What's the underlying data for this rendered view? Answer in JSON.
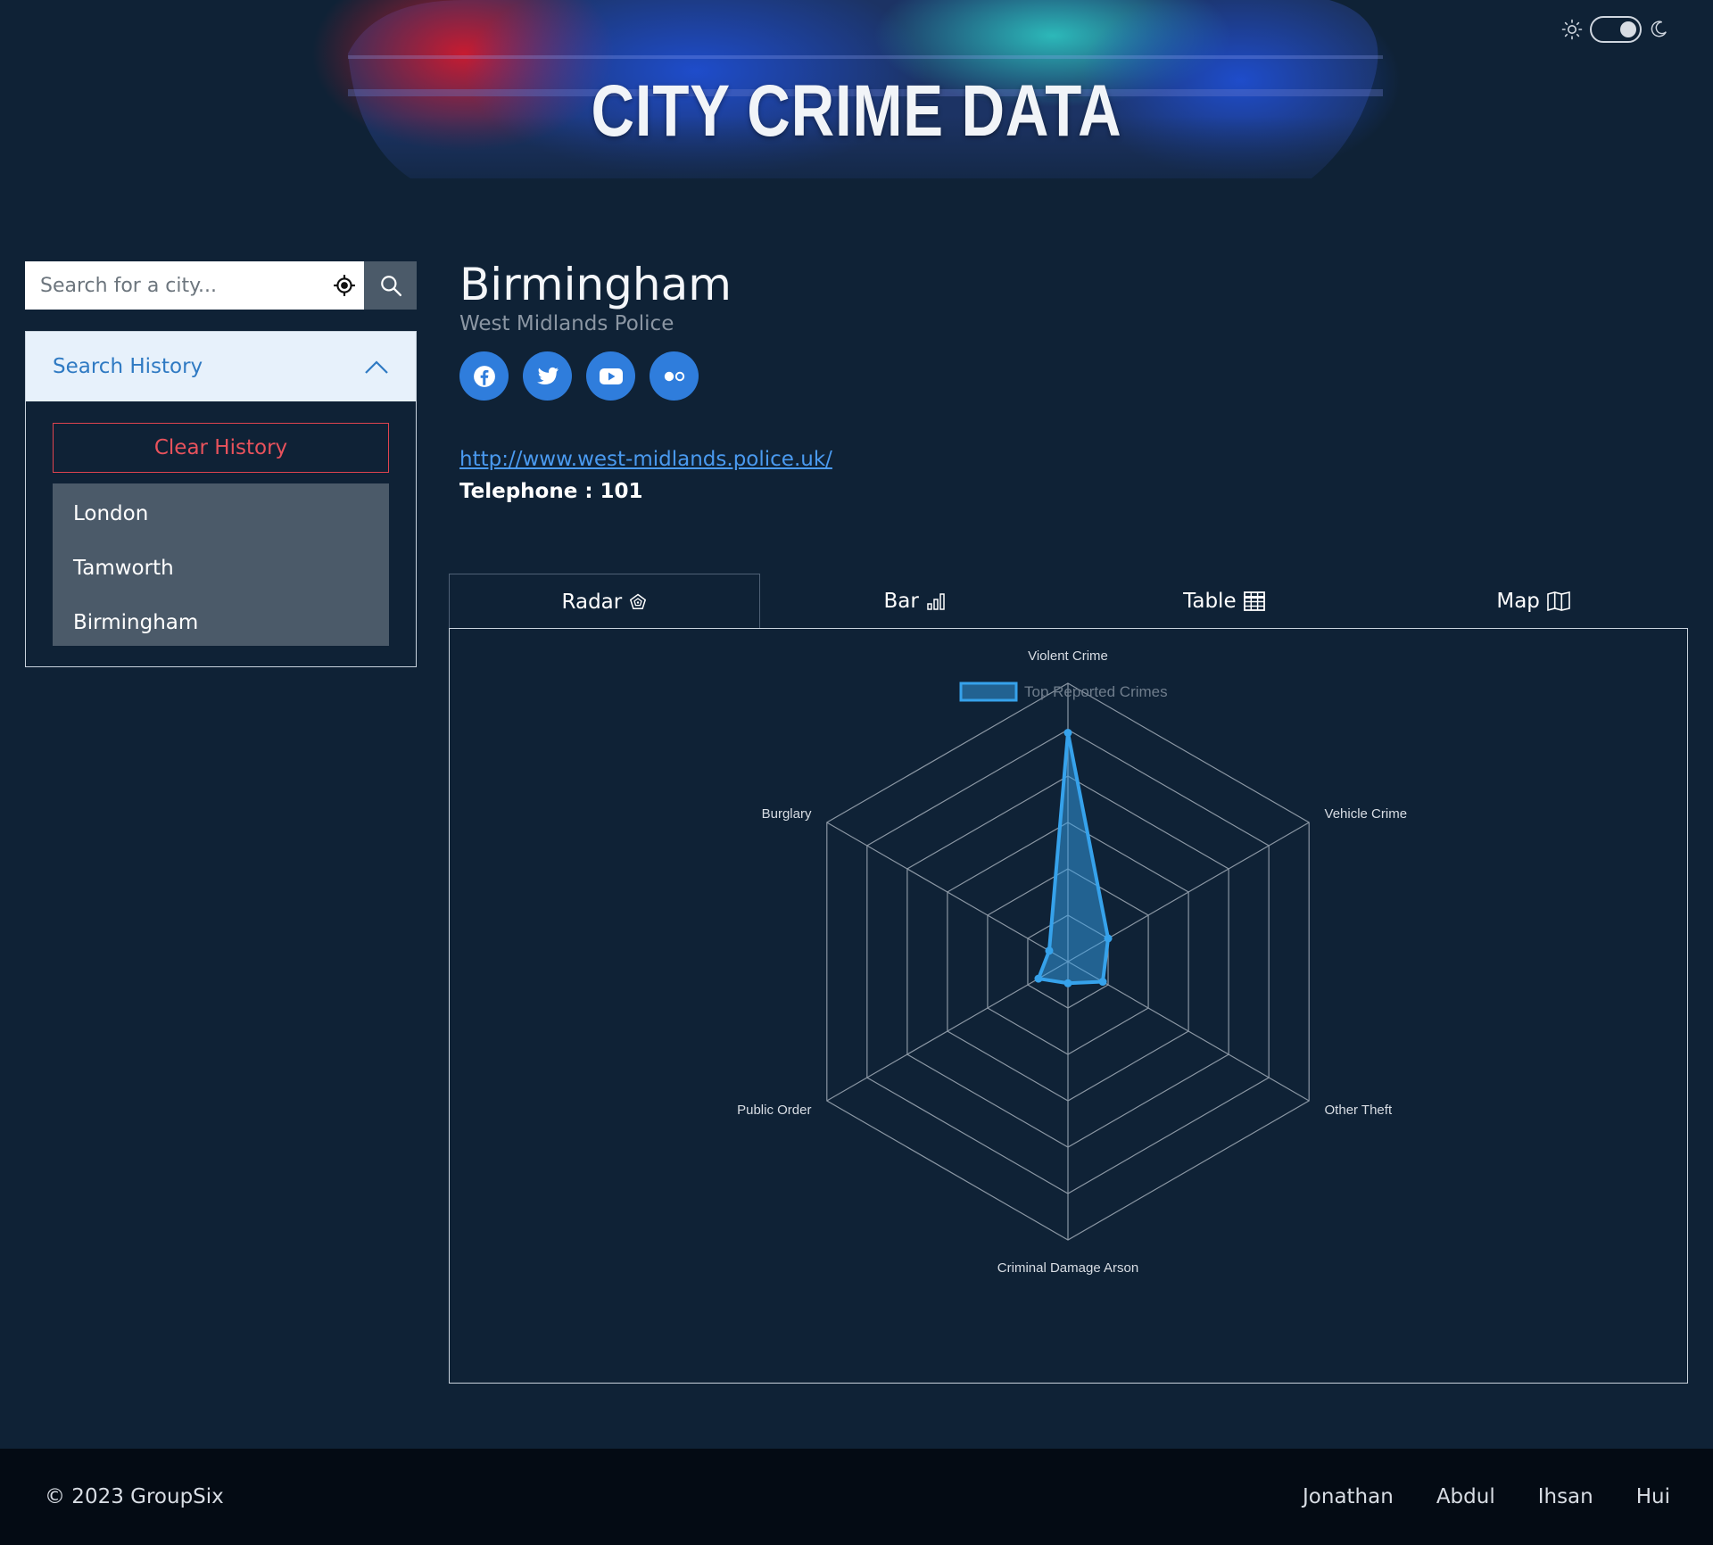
{
  "header": {
    "title": "CITY CRIME DATA",
    "theme_toggle": {
      "state": "dark",
      "sun_icon": "sun-icon",
      "moon_icon": "moon-icon"
    }
  },
  "search": {
    "placeholder": "Search for a city...",
    "value": "",
    "locate_icon": "crosshair-icon",
    "button_icon": "search-icon"
  },
  "history": {
    "title": "Search History",
    "expanded": true,
    "clear_label": "Clear History",
    "items": [
      "London",
      "Tamworth",
      "Birmingham"
    ]
  },
  "city": {
    "name": "Birmingham",
    "force": "West Midlands Police",
    "socials": [
      "facebook-icon",
      "twitter-icon",
      "youtube-icon",
      "flickr-icon"
    ],
    "url": "http://www.west-midlands.police.uk/",
    "telephone_label": "Telephone : 101"
  },
  "tabs": [
    {
      "label": "Radar",
      "icon": "radar-icon",
      "active": true
    },
    {
      "label": "Bar",
      "icon": "bar-chart-icon",
      "active": false
    },
    {
      "label": "Table",
      "icon": "table-icon",
      "active": false
    },
    {
      "label": "Map",
      "icon": "map-icon",
      "active": false
    }
  ],
  "chart_data": {
    "type": "radar",
    "categories": [
      "Violent Crime",
      "Vehicle Crime",
      "Other Theft",
      "Criminal Damage Arson",
      "Public Order",
      "Burglary"
    ],
    "series": [
      {
        "name": "Top Reported Crimes",
        "values": [
          3700,
          750,
          650,
          350,
          550,
          350
        ]
      }
    ],
    "rlim": [
      0,
      4500
    ],
    "grid": true,
    "legend": "top-center",
    "colors": {
      "line": "#36a2eb",
      "fill": "rgba(54,162,235,0.5)",
      "grid": "#8a96a3"
    }
  },
  "footer": {
    "copyright": "© 2023 GroupSix",
    "authors": [
      "Jonathan",
      "Abdul",
      "Ihsan",
      "Hui"
    ]
  },
  "colors": {
    "background": "#0f2236",
    "accent": "#2f7ddc",
    "danger": "#e0444f",
    "footer": "#040b14"
  }
}
